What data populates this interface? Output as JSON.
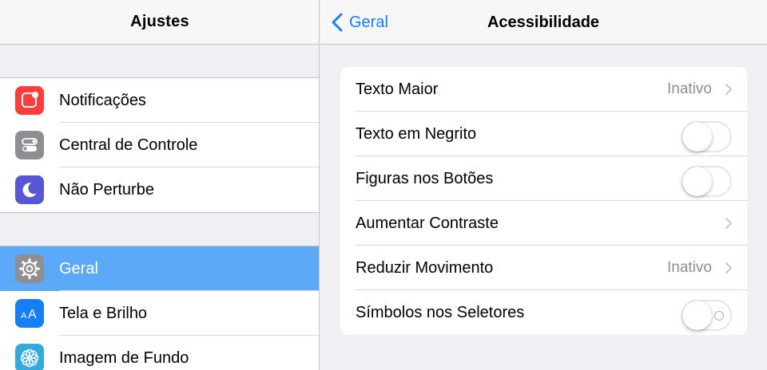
{
  "left": {
    "title": "Ajustes",
    "groups": [
      {
        "items": [
          {
            "label": "Notificações",
            "icon": "notifications-icon",
            "color": "#fc3d39"
          },
          {
            "label": "Central de Controle",
            "icon": "control-center-icon",
            "color": "#8e8e93"
          },
          {
            "label": "Não Perturbe",
            "icon": "moon-icon",
            "color": "#5856d6"
          }
        ]
      },
      {
        "items": [
          {
            "label": "Geral",
            "icon": "gear-icon",
            "color": "#8e8e93",
            "selected": true
          },
          {
            "label": "Tela e Brilho",
            "icon": "display-brightness-icon",
            "color": "#157efb"
          },
          {
            "label": "Imagem de Fundo",
            "icon": "wallpaper-icon",
            "color": "#34aadc"
          }
        ]
      }
    ]
  },
  "right": {
    "back_label": "Geral",
    "title": "Acessibilidade",
    "rows": [
      {
        "label": "Texto Maior",
        "type": "disclosure",
        "value": "Inativo"
      },
      {
        "label": "Texto em Negrito",
        "type": "toggle",
        "on": false
      },
      {
        "label": "Figuras nos Botões",
        "type": "toggle",
        "on": false
      },
      {
        "label": "Aumentar Contraste",
        "type": "disclosure",
        "value": ""
      },
      {
        "label": "Reduzir Movimento",
        "type": "disclosure",
        "value": "Inativo"
      },
      {
        "label": "Símbolos nos Seletores",
        "type": "toggle",
        "on": false,
        "show_off_symbol": true
      }
    ]
  },
  "colors": {
    "accent": "#157efb",
    "selection": "#5ca8f9",
    "secondary_text": "#8e8e93",
    "background": "#efeff4"
  }
}
